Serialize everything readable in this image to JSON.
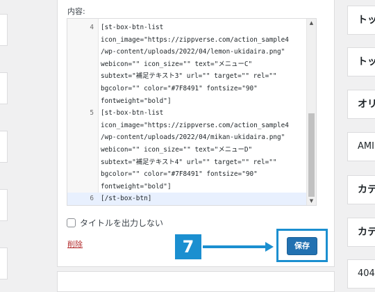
{
  "editor": {
    "label": "内容:",
    "lines": [
      {
        "num": "4",
        "text": "[st-box-btn-list"
      },
      {
        "num": "",
        "text": "icon_image=\"https://zippverse.com/action_sample4"
      },
      {
        "num": "",
        "text": "/wp-content/uploads/2022/04/lemon-ukidaira.png\""
      },
      {
        "num": "",
        "text": "webicon=\"\" icon_size=\"\" text=\"メニューC\""
      },
      {
        "num": "",
        "text": "subtext=\"補足テキスト3\" url=\"\" target=\"\" rel=\"\""
      },
      {
        "num": "",
        "text": "bgcolor=\"\" color=\"#7F8491\" fontsize=\"90\""
      },
      {
        "num": "",
        "text": "fontweight=\"bold\"]"
      },
      {
        "num": "5",
        "text": "[st-box-btn-list"
      },
      {
        "num": "",
        "text": "icon_image=\"https://zippverse.com/action_sample4"
      },
      {
        "num": "",
        "text": "/wp-content/uploads/2022/04/mikan-ukidaira.png\""
      },
      {
        "num": "",
        "text": "webicon=\"\" icon_size=\"\" text=\"メニューD\""
      },
      {
        "num": "",
        "text": "subtext=\"補足テキスト4\" url=\"\" target=\"\" rel=\"\""
      },
      {
        "num": "",
        "text": "bgcolor=\"\" color=\"#7F8491\" fontsize=\"90\""
      },
      {
        "num": "",
        "text": "fontweight=\"bold\"]"
      },
      {
        "num": "6",
        "text": "[/st-box-btn]"
      }
    ]
  },
  "checkbox": {
    "label": "タイトルを出力しない"
  },
  "delete_link": "削除",
  "step_badge": "7",
  "save_button": "保存",
  "right_list": [
    "トッ",
    "トッ",
    "オリ",
    "AMI",
    "カテ",
    "カテ",
    "404"
  ],
  "colors": {
    "accent": "#1b8fd0",
    "primary_button": "#2271b1",
    "delete": "#b32d2e"
  }
}
